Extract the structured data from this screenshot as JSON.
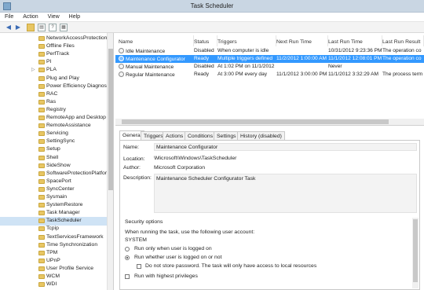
{
  "window": {
    "title": "Task Scheduler"
  },
  "menu": [
    "File",
    "Action",
    "View",
    "Help"
  ],
  "toolbar": {
    "back_icon": "back-arrow",
    "forward_icon": "forward-arrow"
  },
  "tree": {
    "items": [
      {
        "label": "NetworkAccessProtection",
        "expandable": false,
        "selected": false
      },
      {
        "label": "Offline Files",
        "expandable": false,
        "selected": false
      },
      {
        "label": "PerfTrack",
        "expandable": false,
        "selected": false
      },
      {
        "label": "PI",
        "expandable": false,
        "selected": false
      },
      {
        "label": "PLA",
        "expandable": true,
        "selected": false
      },
      {
        "label": "Plug and Play",
        "expandable": false,
        "selected": false
      },
      {
        "label": "Power Efficiency Diagnosti",
        "expandable": false,
        "selected": false
      },
      {
        "label": "RAC",
        "expandable": false,
        "selected": false
      },
      {
        "label": "Ras",
        "expandable": false,
        "selected": false
      },
      {
        "label": "Registry",
        "expandable": false,
        "selected": false
      },
      {
        "label": "RemoteApp and Desktop C",
        "expandable": false,
        "selected": false
      },
      {
        "label": "RemoteAssistance",
        "expandable": false,
        "selected": false
      },
      {
        "label": "Servicing",
        "expandable": false,
        "selected": false
      },
      {
        "label": "SettingSync",
        "expandable": false,
        "selected": false
      },
      {
        "label": "Setup",
        "expandable": false,
        "selected": false
      },
      {
        "label": "Shell",
        "expandable": false,
        "selected": false
      },
      {
        "label": "SideShow",
        "expandable": false,
        "selected": false
      },
      {
        "label": "SoftwareProtectionPlatforr",
        "expandable": false,
        "selected": false
      },
      {
        "label": "SpacePort",
        "expandable": false,
        "selected": false
      },
      {
        "label": "SyncCenter",
        "expandable": false,
        "selected": false
      },
      {
        "label": "Sysmain",
        "expandable": false,
        "selected": false
      },
      {
        "label": "SystemRestore",
        "expandable": false,
        "selected": false
      },
      {
        "label": "Task Manager",
        "expandable": false,
        "selected": false
      },
      {
        "label": "TaskScheduler",
        "expandable": false,
        "selected": true
      },
      {
        "label": "Tcpip",
        "expandable": false,
        "selected": false
      },
      {
        "label": "TextServicesFramework",
        "expandable": false,
        "selected": false
      },
      {
        "label": "Time Synchronization",
        "expandable": false,
        "selected": false
      },
      {
        "label": "TPM",
        "expandable": false,
        "selected": false
      },
      {
        "label": "UPnP",
        "expandable": false,
        "selected": false
      },
      {
        "label": "User Profile Service",
        "expandable": false,
        "selected": false
      },
      {
        "label": "WCM",
        "expandable": false,
        "selected": false
      },
      {
        "label": "WDI",
        "expandable": false,
        "selected": false
      }
    ]
  },
  "tasks": {
    "columns": [
      "Name",
      "Status",
      "Triggers",
      "Next Run Time",
      "Last Run Time",
      "Last Run Result"
    ],
    "rows": [
      {
        "name": "Idle Maintenance",
        "status": "Disabled",
        "triggers": "When computer is idle",
        "next": "",
        "last": "10/31/2012 9:23:36 PM",
        "result": "The operation co",
        "selected": false
      },
      {
        "name": "Maintenance Configurator",
        "status": "Ready",
        "triggers": "Multiple triggers defined",
        "next": "11/2/2012 1:00:00 AM",
        "last": "11/1/2012 12:08:01 PM",
        "result": "The operation co",
        "selected": true
      },
      {
        "name": "Manual Maintenance",
        "status": "Disabled",
        "triggers": "At 1:02 PM on 11/1/2012",
        "next": "",
        "last": "Never",
        "result": "",
        "selected": false
      },
      {
        "name": "Regular Maintenance",
        "status": "Ready",
        "triggers": "At 3:00 PM every day",
        "next": "11/1/2012 3:00:00 PM",
        "last": "11/1/2012 3:32:29 AM",
        "result": "The process term",
        "selected": false
      }
    ]
  },
  "detail_tabs": [
    "General",
    "Triggers",
    "Actions",
    "Conditions",
    "Settings",
    "History (disabled)"
  ],
  "general": {
    "name_label": "Name:",
    "name_value": "Maintenance Configurator",
    "location_label": "Location:",
    "location_value": "\\Microsoft\\Windows\\TaskScheduler",
    "author_label": "Author:",
    "author_value": "Microsoft Corporation",
    "description_label": "Description:",
    "description_value": "Maintenance Scheduler Configurator Task",
    "security_heading": "Security options",
    "account_prompt": "When running the task, use the following user account:",
    "account_value": "SYSTEM",
    "opt_logged_on": "Run only when user is logged on",
    "opt_whether": "Run whether user is logged on or not",
    "opt_no_password": "Do not store password.  The task will only have access to local resources",
    "opt_highest": "Run with highest privileges"
  }
}
